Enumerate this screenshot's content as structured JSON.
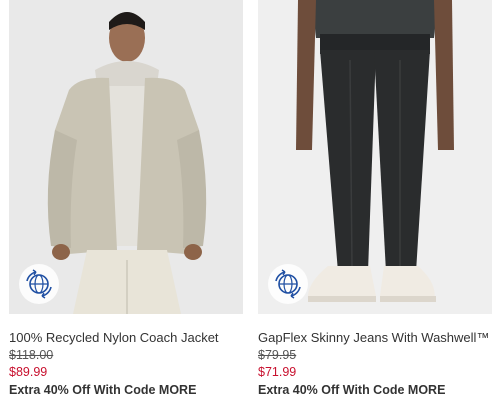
{
  "products": [
    {
      "name": "100% Recycled Nylon Coach Jacket",
      "original_price": "$118.00",
      "sale_price": "$89.99",
      "promo": "Extra 40% Off With Code MORE",
      "badge_icon": "globe-recycle-icon"
    },
    {
      "name": "GapFlex Skinny Jeans With Washwell™",
      "original_price": "$79.95",
      "sale_price": "$71.99",
      "promo": "Extra 40% Off With Code MORE",
      "badge_icon": "globe-recycle-icon"
    }
  ],
  "colors": {
    "sale_price": "#c8102e",
    "badge_accent": "#1f4fa3"
  }
}
